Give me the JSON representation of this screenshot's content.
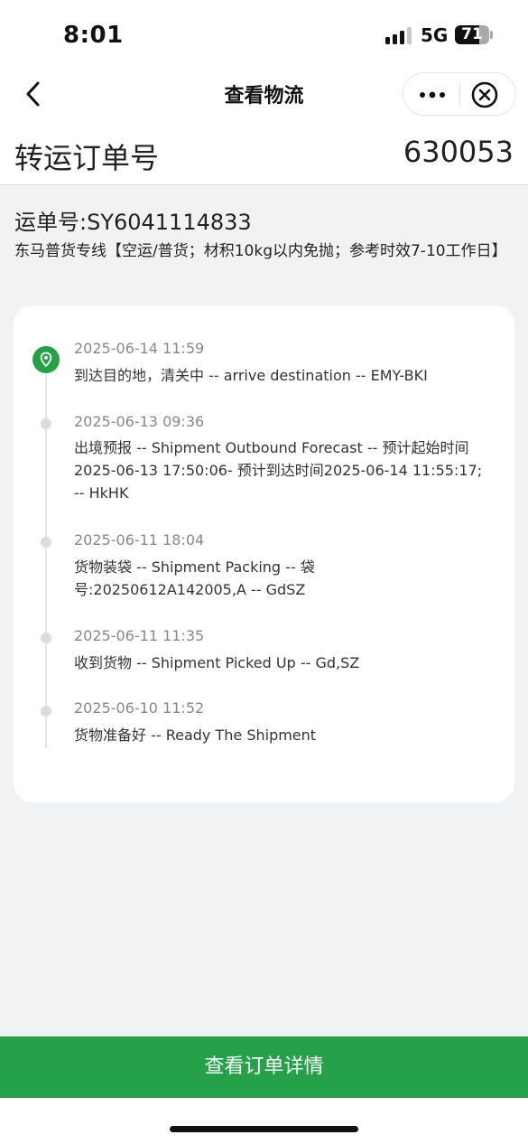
{
  "status_bar": {
    "time": "8:01",
    "network": "5G",
    "battery": "71",
    "battery_level": 0.71,
    "signal_bars_active": 3,
    "signal_bars_total": 4
  },
  "nav": {
    "title": "查看物流",
    "back_icon": "chevron-left-icon",
    "more_icon": "more-dots-icon",
    "close_icon": "close-circle-icon"
  },
  "order": {
    "label": "转运订单号",
    "number": "630053"
  },
  "waybill": {
    "text": "运单号:SY6041114833",
    "service": "东马普货专线【空运/普货；材积10kg以内免抛；参考时效7-10工作日】"
  },
  "timeline": [
    {
      "time": "2025-06-14 11:59",
      "text": "到达目的地，清关中 -- arrive destination -- EMY-BKI",
      "current": true
    },
    {
      "time": "2025-06-13 09:36",
      "text": "出境预报 -- Shipment Outbound Forecast -- 预计起始时间2025-06-13 17:50:06- 预计到达时间2025-06-14 11:55:17; -- HkHK",
      "current": false
    },
    {
      "time": "2025-06-11 18:04",
      "text": "货物装袋 -- Shipment Packing -- 袋号:20250612A142005,A -- GdSZ",
      "current": false
    },
    {
      "time": "2025-06-11 11:35",
      "text": "收到货物 -- Shipment Picked Up -- Gd,SZ",
      "current": false
    },
    {
      "time": "2025-06-10 11:52",
      "text": "货物准备好 -- Ready The Shipment",
      "current": false
    }
  ],
  "colors": {
    "accent": "#25a14a",
    "background": "#f1f2f4",
    "card": "#ffffff"
  },
  "footer": {
    "button_label": "查看订单详情"
  }
}
